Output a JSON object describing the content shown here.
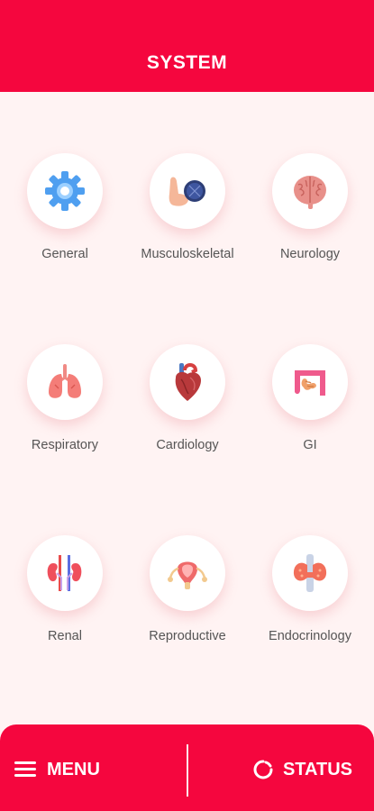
{
  "header": {
    "title": "SYSTEM"
  },
  "systems": [
    {
      "label": "General",
      "icon": "gear-icon"
    },
    {
      "label": "Musculoskeletal",
      "icon": "muscle-icon"
    },
    {
      "label": "Neurology",
      "icon": "brain-icon"
    },
    {
      "label": "Respiratory",
      "icon": "lungs-icon"
    },
    {
      "label": "Cardiology",
      "icon": "heart-icon"
    },
    {
      "label": "GI",
      "icon": "intestine-icon"
    },
    {
      "label": "Renal",
      "icon": "kidneys-icon"
    },
    {
      "label": "Reproductive",
      "icon": "uterus-icon"
    },
    {
      "label": "Endocrinology",
      "icon": "thyroid-icon"
    }
  ],
  "bottom_bar": {
    "menu_label": "MENU",
    "status_label": "STATUS"
  },
  "colors": {
    "accent": "#f5063e",
    "background": "#fff3f3",
    "label": "#555555"
  }
}
